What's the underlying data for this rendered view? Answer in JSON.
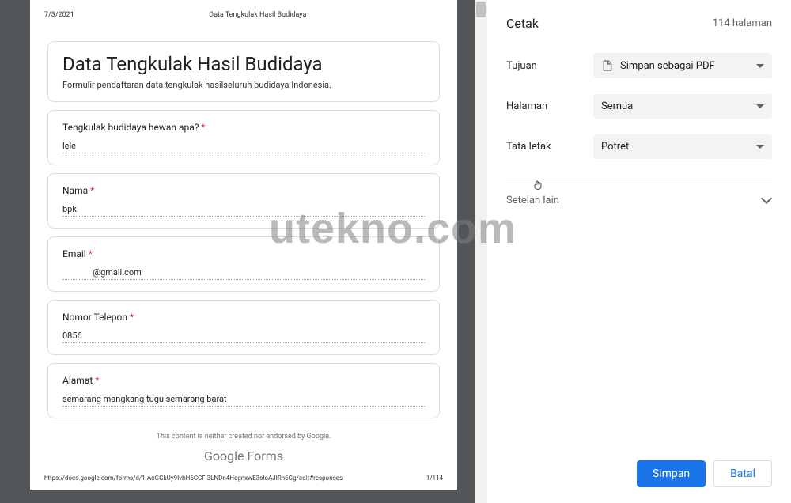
{
  "preview": {
    "date": "7/3/2021",
    "headerTitle": "Data Tengkulak Hasil Budidaya",
    "formTitle": "Data Tengkulak Hasil Budidaya",
    "formDesc": "Formulir pendaftaran data tengkulak  hasilseluruh budidaya Indonesia.",
    "fields": [
      {
        "label": "Tengkulak budidaya hewan apa?",
        "value": "lele"
      },
      {
        "label": "Nama",
        "value": "bpk"
      },
      {
        "label": "Email",
        "value": "@gmail.com"
      },
      {
        "label": "Nomor Telepon",
        "value": "0856"
      },
      {
        "label": "Alamat",
        "value": "semarang mangkang tugu semarang barat"
      }
    ],
    "footerDisclaimer": "This content is neither created nor endorsed by Google.",
    "googleForms": "Google Forms",
    "footerUrl": "https://docs.google.com/forms/d/1-AoGGkUy9IvbH6CCFi3LNDn4HegnxwE3sIoAJIRh6Gg/edit#responses",
    "pageIndicator": "1/114"
  },
  "panel": {
    "title": "Cetak",
    "pageCount": "114 halaman",
    "settings": {
      "destinationLabel": "Tujuan",
      "destinationValue": "Simpan sebagai PDF",
      "pagesLabel": "Halaman",
      "pagesValue": "Semua",
      "layoutLabel": "Tata letak",
      "layoutValue": "Potret"
    },
    "moreSettings": "Setelan lain",
    "saveButton": "Simpan",
    "cancelButton": "Batal"
  },
  "watermark": "utekno.com"
}
